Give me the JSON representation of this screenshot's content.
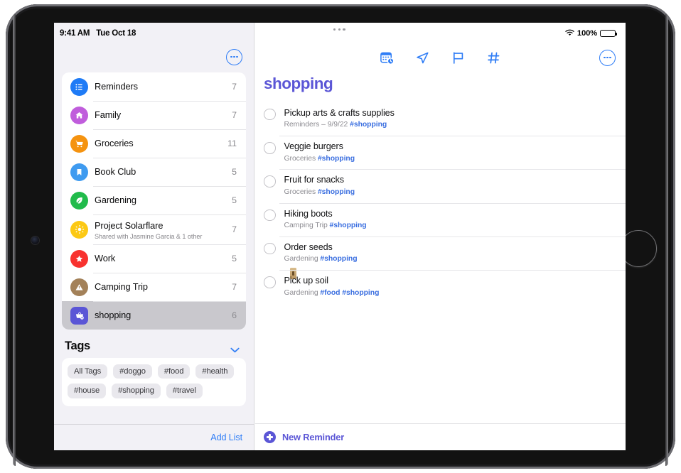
{
  "status_bar": {
    "time": "9:41 AM",
    "date": "Tue Oct 18",
    "battery_percent": "100%",
    "wifi_icon": "wifi-icon",
    "battery_icon": "battery-full-icon"
  },
  "sidebar": {
    "more_button_icon": "circle-ellipsis-icon",
    "lists": [
      {
        "label": "Reminders",
        "count": "7",
        "icon": "list-bullet-icon",
        "color": "#1f7bf6",
        "subtitle": ""
      },
      {
        "label": "Family",
        "count": "7",
        "icon": "house-icon",
        "color": "#c05ddc",
        "subtitle": ""
      },
      {
        "label": "Groceries",
        "count": "11",
        "icon": "cart-icon",
        "color": "#f59310",
        "subtitle": ""
      },
      {
        "label": "Book Club",
        "count": "5",
        "icon": "bookmark-icon",
        "color": "#3f9bf0",
        "subtitle": ""
      },
      {
        "label": "Gardening",
        "count": "5",
        "icon": "leaf-icon",
        "color": "#21bb4b",
        "subtitle": ""
      },
      {
        "label": "Project Solarflare",
        "count": "7",
        "icon": "sun-icon",
        "color": "#fcc915",
        "subtitle": "Shared with Jasmine Garcia & 1 other"
      },
      {
        "label": "Work",
        "count": "5",
        "icon": "star-icon",
        "color": "#f8322f",
        "subtitle": ""
      },
      {
        "label": "Camping Trip",
        "count": "7",
        "icon": "tent-icon",
        "color": "#a38159",
        "subtitle": ""
      },
      {
        "label": "shopping",
        "count": "6",
        "icon": "basket-icon",
        "color": "#5b56d6",
        "subtitle": "",
        "selected": true
      }
    ],
    "tags_section": {
      "title": "Tags",
      "collapse_icon": "chevron-down-icon",
      "tags": [
        "All Tags",
        "#doggo",
        "#food",
        "#health",
        "#house",
        "#shopping",
        "#travel"
      ]
    },
    "add_list_label": "Add List"
  },
  "detail": {
    "multitask_icon": "multitask-dots-icon",
    "toolbar": [
      {
        "icon": "calendar-clock-icon"
      },
      {
        "icon": "location-arrow-icon"
      },
      {
        "icon": "flag-icon"
      },
      {
        "icon": "hashtag-icon"
      }
    ],
    "more_button_icon": "circle-ellipsis-icon",
    "title": "shopping",
    "title_color": "#5b56d6",
    "accent_blue": "#2f7df6",
    "tag_color": "#3b6fe0",
    "reminders": [
      {
        "title": "Pickup arts & crafts supplies",
        "source": "Reminders – 9/9/22 ",
        "tags": "#shopping",
        "thumbnail": false
      },
      {
        "title": "Veggie burgers",
        "source": "Groceries ",
        "tags": "#shopping",
        "thumbnail": false
      },
      {
        "title": "Fruit for snacks",
        "source": "Groceries ",
        "tags": "#shopping",
        "thumbnail": false
      },
      {
        "title": "Hiking boots",
        "source": "Camping Trip ",
        "tags": "#shopping",
        "thumbnail": false
      },
      {
        "title": "Order seeds",
        "source": "Gardening ",
        "tags": "#shopping",
        "thumbnail": true
      },
      {
        "title": "Pick up soil",
        "source": "Gardening ",
        "tags": "#food #shopping",
        "thumbnail": false
      }
    ],
    "new_reminder_label": "New Reminder",
    "new_reminder_icon": "plus-circle-icon"
  }
}
